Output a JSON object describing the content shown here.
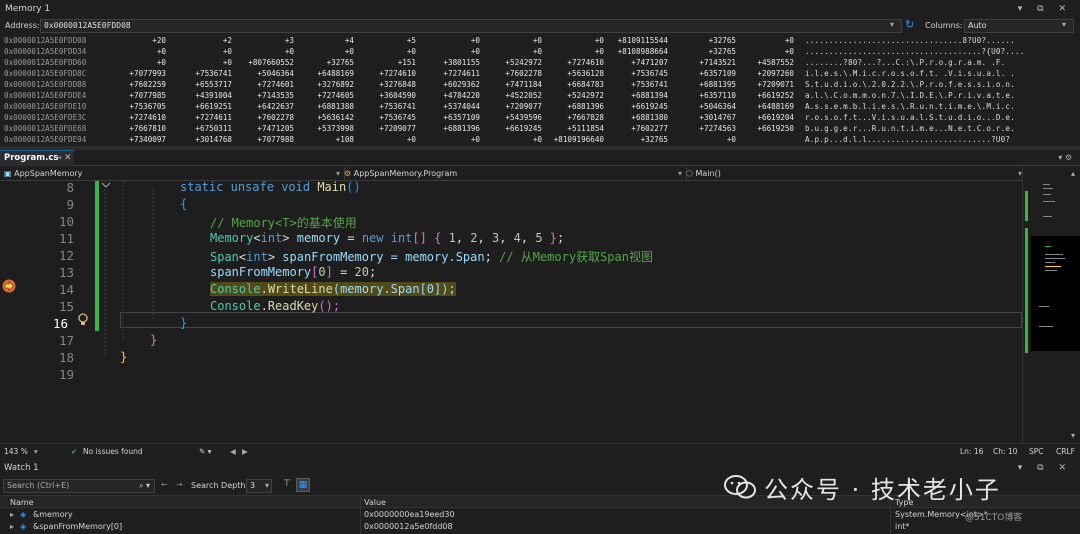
{
  "memory": {
    "title": "Memory 1",
    "address_label": "Address:",
    "address_value": "0x0000012A5E0FDD08",
    "columns_label": "Columns:",
    "columns_value": "Auto",
    "rows": [
      {
        "addr": "0x0000012A5E0FDD08",
        "vals": [
          "+20",
          "+2",
          "+3",
          "+4",
          "+5",
          "+0",
          "+0",
          "+0",
          "+8109115544",
          "+32765",
          "+0"
        ],
        "text": ".................................8?U0?......"
      },
      {
        "addr": "0x0000012A5E0FDD34",
        "vals": [
          "+0",
          "+0",
          "+0",
          "+0",
          "+0",
          "+0",
          "+0",
          "+0",
          "+8108988664",
          "+32765",
          "+0"
        ],
        "text": ".....................................?{U0?...."
      },
      {
        "addr": "0x0000012A5E0FDD60",
        "vals": [
          "+0",
          "+0",
          "+807660552",
          "+32765",
          "+151",
          "+3801155",
          "+5242972",
          "+7274610",
          "+7471207",
          "+7143521",
          "+4587552"
        ],
        "text": "........?80?...?...C.:\\.P.r.o.g.r.a.m. .F."
      },
      {
        "addr": "0x0000012A5E0FDD8C",
        "vals": [
          "+7077993",
          "+7536741",
          "+5046364",
          "+6488169",
          "+7274610",
          "+7274611",
          "+7602278",
          "+5636128",
          "+7536745",
          "+6357109",
          "+2097260"
        ],
        "text": "i.l.e.s.\\.M.i.c.r.o.s.o.f.t. .V.i.s.u.a.l. ."
      },
      {
        "addr": "0x0000012A5E0FDDB8",
        "vals": [
          "+7602259",
          "+6553717",
          "+7274601",
          "+3276892",
          "+3276848",
          "+6029362",
          "+7471184",
          "+6684783",
          "+7536741",
          "+6881395",
          "+7209071"
        ],
        "text": "S.t.u.d.i.o.\\.2.0.2.2.\\.P.r.o.f.e.s.s.i.o.n."
      },
      {
        "addr": "0x0000012A5E0FDDE4",
        "vals": [
          "+7077985",
          "+4391004",
          "+7143535",
          "+7274605",
          "+3604590",
          "+4784220",
          "+4522052",
          "+5242972",
          "+6881394",
          "+6357110",
          "+6619252"
        ],
        "text": "a.l.\\.C.o.m.m.o.n.7.\\.I.D.E.\\.P.r.i.v.a.t.e."
      },
      {
        "addr": "0x0000012A5E0FDE10",
        "vals": [
          "+7536705",
          "+6619251",
          "+6422637",
          "+6881388",
          "+7536741",
          "+5374044",
          "+7209077",
          "+6881396",
          "+6619245",
          "+5046364",
          "+6488169"
        ],
        "text": "A.s.s.e.m.b.l.i.e.s.\\.R.u.n.t.i.m.e.\\.M.i.c."
      },
      {
        "addr": "0x0000012A5E0FDE3C",
        "vals": [
          "+7274610",
          "+7274611",
          "+7602278",
          "+5636142",
          "+7536745",
          "+6357109",
          "+5439596",
          "+7667828",
          "+6881380",
          "+3014767",
          "+6619204"
        ],
        "text": "r.o.s.o.f.t...V.i.s.u.a.l.S.t.u.d.i.o...D.e."
      },
      {
        "addr": "0x0000012A5E0FDE68",
        "vals": [
          "+7667810",
          "+6750311",
          "+7471205",
          "+5373998",
          "+7209077",
          "+6881396",
          "+6619245",
          "+5111854",
          "+7602277",
          "+7274563",
          "+6619250"
        ],
        "text": "b.u.g.g.e.r...R.u.n.t.i.m.e...N.e.t.C.o.r.e."
      },
      {
        "addr": "0x0000012A5E0FDE94",
        "vals": [
          "+7340097",
          "+3014768",
          "+7077988",
          "+108",
          "+0",
          "+0",
          "+0",
          "+8109196640",
          "+32765",
          "+0",
          ""
        ],
        "text": "A.p.p...d.l.l..........................?U0?"
      }
    ]
  },
  "tabs": {
    "active_label": "Program.cs",
    "pin_icon": "pin-icon",
    "close_icon": "close-icon"
  },
  "navbar": {
    "project": "AppSpanMemory",
    "class": "AppSpanMemory.Program",
    "member": "Main()"
  },
  "editor": {
    "line_numbers": [
      "8",
      "9",
      "10",
      "11",
      "12",
      "13",
      "14",
      "15",
      "16",
      "17",
      "18",
      "19"
    ],
    "current_line": "16",
    "lines": {
      "l8_kw1": "static",
      "l8_kw2": "unsafe",
      "l8_kw3": "void",
      "l8_fn": "Main",
      "l8_parens": "()",
      "l9": "{",
      "l10": "// Memory<T>的基本使用",
      "l11_ty": "Memory",
      "l11_lt": "<",
      "l11_kw": "int",
      "l11_gt": ">",
      "l11_var": "memory",
      "l11_eq": "=",
      "l11_new": "new",
      "l11_int": "int",
      "l11_arr": "[]",
      "l11_ob": "{",
      "l11_n1": "1",
      "l11_n2": "2",
      "l11_n3": "3",
      "l11_n4": "4",
      "l11_n5": "5",
      "l11_cb": "}",
      "l11_semi": ";",
      "l12_ty": "Span",
      "l12_lt": "<",
      "l12_kw": "int",
      "l12_gt": ">",
      "l12_var": "spanFromMemory",
      "l12_rest": " = memory.",
      "l12_prop": "Span",
      "l12_semi": "; ",
      "l12_cm": "// 从Memory获取Span视图",
      "l13_var": "spanFromMemory",
      "l13_ob": "[",
      "l13_idx": "0",
      "l13_cb": "]",
      "l13_eq": " = ",
      "l13_val": "20",
      "l13_semi": ";",
      "l14_ty": "Console",
      "l14_dot": ".",
      "l14_fn": "WriteLine",
      "l14_args": "(memory.Span[0]);",
      "l15_ty": "Console",
      "l15_dot": ".",
      "l15_fn": "ReadKey",
      "l15_args": "();",
      "l16": "}",
      "l17": "}",
      "l18": "}"
    }
  },
  "status": {
    "zoom": "143 %",
    "issues": "No issues found",
    "ln": "Ln: 16",
    "ch": "Ch: 10",
    "spc": "SPC",
    "crlf": "CRLF"
  },
  "watch": {
    "title": "Watch 1",
    "search_placeholder": "Search (Ctrl+E)",
    "search_depth_label": "Search Depth:",
    "search_depth_value": "3",
    "col_name": "Name",
    "col_value": "Value",
    "col_type": "Type",
    "rows": [
      {
        "name": "&memory",
        "value": "0x0000000ea19eed30",
        "type": "System.Memory<int>*"
      },
      {
        "name": "&spanFromMemory[0]",
        "value": "0x0000012a5e0fdd08",
        "type": "int*"
      }
    ]
  },
  "watermark": {
    "text": "公众号 · 技术老小子",
    "sub": "@51CTO博客"
  },
  "colors": {
    "accent": "#0e639c",
    "breakpoint": "#e06c3a",
    "changebar": "#3bb54a"
  }
}
